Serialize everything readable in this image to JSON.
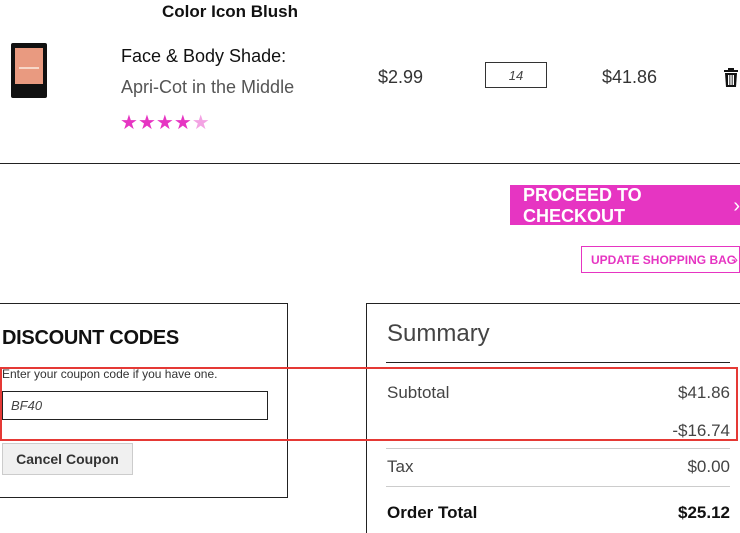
{
  "product": {
    "name": "Color Icon Blush",
    "shade_label": "Face & Body Shade:",
    "shade_value": "Apri-Cot in the Middle",
    "rating_stars": 4.5,
    "unit_price": "$2.99",
    "quantity": "14",
    "line_total": "$41.86"
  },
  "actions": {
    "checkout_label": "PROCEED TO CHECKOUT",
    "update_label": "UPDATE SHOPPING BAG"
  },
  "discount": {
    "title": "DISCOUNT CODES",
    "hint": "Enter your coupon code if you have one.",
    "code": "BF40",
    "cancel_label": "Cancel Coupon"
  },
  "summary": {
    "title": "Summary",
    "subtotal_label": "Subtotal",
    "subtotal_value": "$41.86",
    "discount_value": "-$16.74",
    "tax_label": "Tax",
    "tax_value": "$0.00",
    "total_label": "Order Total",
    "total_value": "$25.12"
  },
  "colors": {
    "accent": "#e635c2",
    "highlight": "#e53935"
  }
}
